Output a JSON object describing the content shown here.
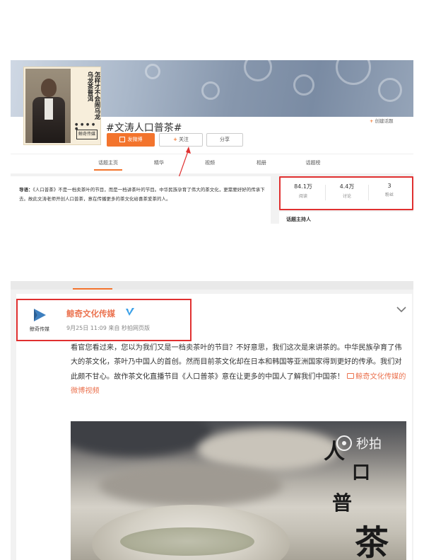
{
  "top": {
    "cover": {
      "vertical_text": "怎样才不会闹乌龙 乌龙茶普洱",
      "logo_text": "鲸奇传媒"
    },
    "topic_title": "#文涛人口普茶#",
    "buttons": {
      "post": "发微博",
      "follow": "关注",
      "share": "分享"
    },
    "create_topic": "创建话题",
    "nav_tabs": [
      "话题主页",
      "精华",
      "视频",
      "相册",
      "话题榜"
    ],
    "active_tab": "话题主页",
    "guide": {
      "label": "导语：",
      "text": "《人口普茶》不是一档卖茶叶的节目，而是一档讲茶叶的节目。中华民族孕育了伟大的茶文化，更需要好好的传承下去。故此文涛老师开创人口普茶，意在传播更多的茶文化给喜茶爱茶的人。"
    },
    "stats": [
      {
        "value": "84.1万",
        "label": "阅读"
      },
      {
        "value": "4.4万",
        "label": "讨论"
      },
      {
        "value": "3",
        "label": "粉丝"
      }
    ],
    "host_label": "话题主持人",
    "highlight_color": "#e03030",
    "accent_color": "#f3742d"
  },
  "bottom": {
    "author": {
      "avatar_text": "鲸奇传媒",
      "name": "鲸奇文化传媒",
      "verified_icon": "verified-v-icon",
      "meta": "9月25日 11:09 来自 秒拍网页版"
    },
    "post": {
      "text": "看官您看过来，您以为我们又是一档卖茶叶的节目？不好意思，我们这次是来讲茶的。中华民族孕育了伟大的茶文化，茶叶乃中国人的首创。然而目前茶文化却在日本和韩国等亚洲国家得到更好的传承。我们对此颇不甘心。故作茶文化直播节目《人口普茶》意在让更多的中国人了解我们中国茶！",
      "link_text": "鲸奇文化传媒的微博视频"
    },
    "video": {
      "watermark": "秒拍",
      "calligraphy": [
        "人",
        "口",
        "普",
        "茶"
      ]
    },
    "link_color": "#eb7350"
  }
}
